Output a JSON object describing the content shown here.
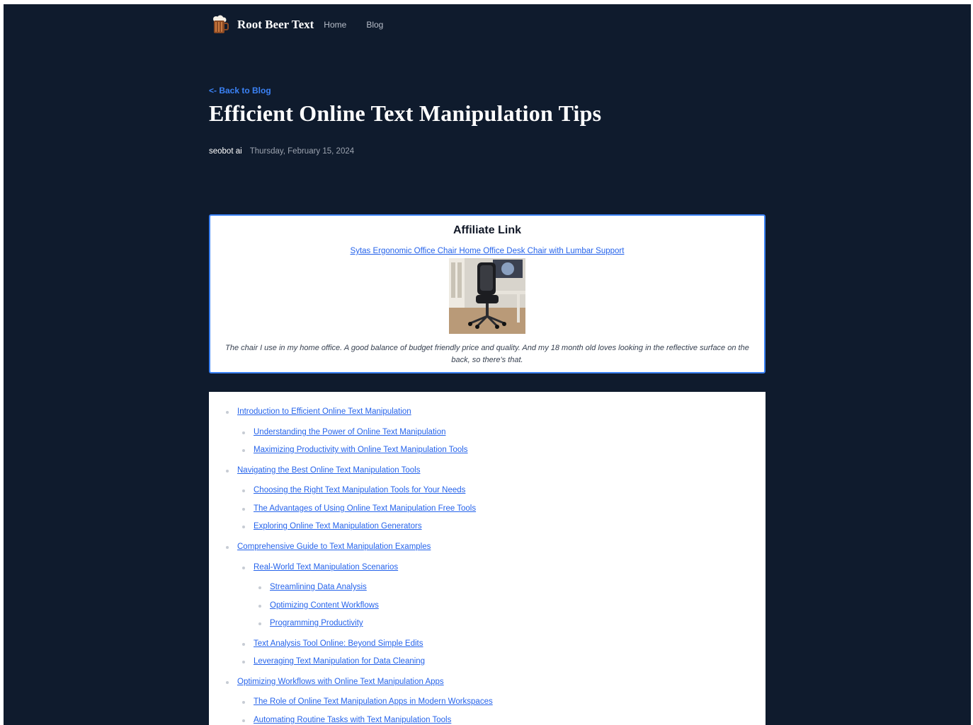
{
  "nav": {
    "brand": "Root Beer Text",
    "links": [
      "Home",
      "Blog"
    ]
  },
  "back_link": "<- Back to Blog",
  "post": {
    "title": "Efficient Online Text Manipulation Tips",
    "author": "seobot ai",
    "date": "Thursday, February 15, 2024"
  },
  "affiliate": {
    "heading": "Affiliate Link",
    "link_text": "Sytas Ergonomic Office Chair Home Office Desk Chair with Lumbar Support",
    "caption": "The chair I use in my home office. A good balance of budget friendly price and quality. And my 18 month old loves looking in the reflective surface on the back, so there's that."
  },
  "toc": [
    {
      "label": "Introduction to Efficient Online Text Manipulation",
      "level": 1
    },
    {
      "label": "Understanding the Power of Online Text Manipulation",
      "level": 2
    },
    {
      "label": "Maximizing Productivity with Online Text Manipulation Tools",
      "level": 2
    },
    {
      "label": "Navigating the Best Online Text Manipulation Tools",
      "level": 1
    },
    {
      "label": "Choosing the Right Text Manipulation Tools for Your Needs",
      "level": 2
    },
    {
      "label": "The Advantages of Using Online Text Manipulation Free Tools",
      "level": 2
    },
    {
      "label": "Exploring Online Text Manipulation Generators",
      "level": 2
    },
    {
      "label": "Comprehensive Guide to Text Manipulation Examples",
      "level": 1
    },
    {
      "label": "Real-World Text Manipulation Scenarios",
      "level": 2
    },
    {
      "label": "Streamlining Data Analysis",
      "level": 3
    },
    {
      "label": "Optimizing Content Workflows",
      "level": 3
    },
    {
      "label": "Programming Productivity",
      "level": 3
    },
    {
      "label": "Text Analysis Tool Online: Beyond Simple Edits",
      "level": 2
    },
    {
      "label": "Leveraging Text Manipulation for Data Cleaning",
      "level": 2
    },
    {
      "label": "Optimizing Workflows with Online Text Manipulation Apps",
      "level": 1
    },
    {
      "label": "The Role of Online Text Manipulation Apps in Modern Workspaces",
      "level": 2
    },
    {
      "label": "Automating Routine Tasks with Text Manipulation Tools",
      "level": 2
    }
  ]
}
